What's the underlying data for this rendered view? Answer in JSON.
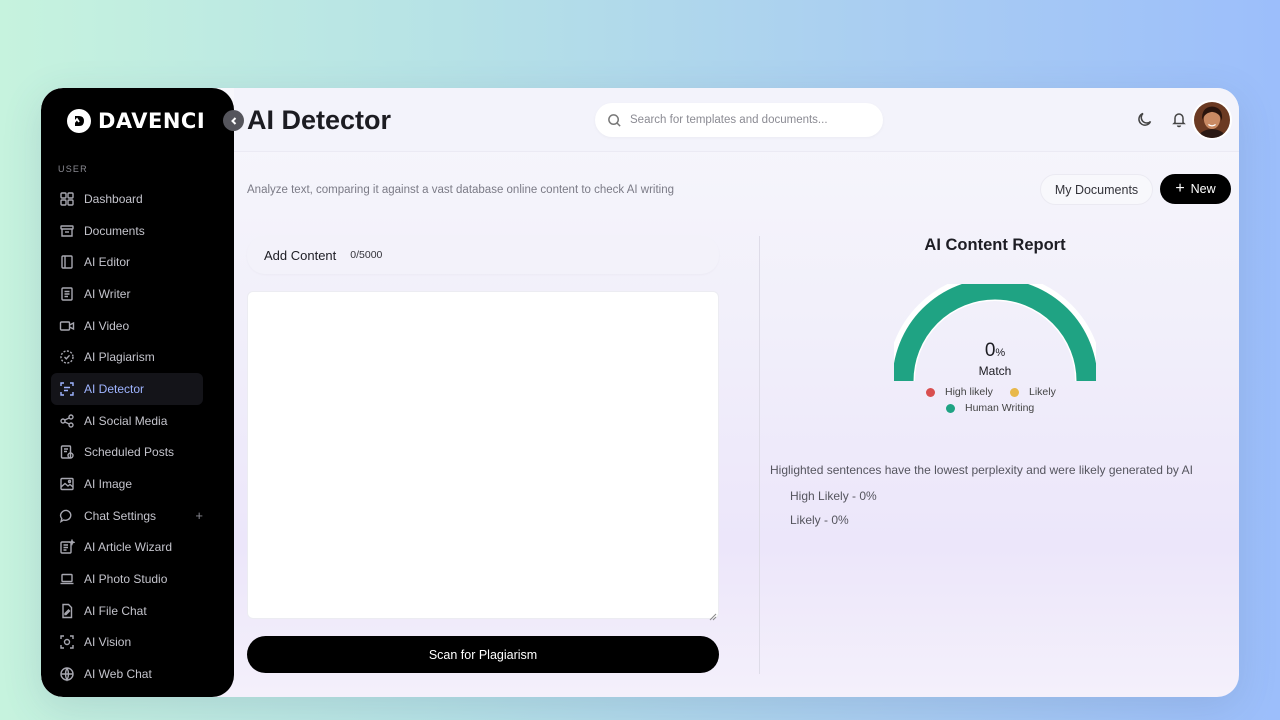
{
  "app": {
    "logo_text": "DAVENCI"
  },
  "sidebar": {
    "section_label": "USER",
    "items": [
      {
        "label": "Dashboard",
        "icon": "dashboard-icon"
      },
      {
        "label": "Documents",
        "icon": "documents-icon"
      },
      {
        "label": "AI Editor",
        "icon": "editor-icon"
      },
      {
        "label": "AI Writer",
        "icon": "writer-icon"
      },
      {
        "label": "AI Video",
        "icon": "video-icon"
      },
      {
        "label": "AI Plagiarism",
        "icon": "plagiarism-icon"
      },
      {
        "label": "AI Detector",
        "icon": "detector-icon",
        "active": true
      },
      {
        "label": "AI Social Media",
        "icon": "share-icon"
      },
      {
        "label": "Scheduled Posts",
        "icon": "calendar-icon"
      },
      {
        "label": "AI Image",
        "icon": "image-icon"
      },
      {
        "label": "Chat Settings",
        "icon": "chat-icon",
        "expandable": true
      },
      {
        "label": "AI Article Wizard",
        "icon": "wizard-icon"
      },
      {
        "label": "AI Photo Studio",
        "icon": "laptop-icon"
      },
      {
        "label": "AI File Chat",
        "icon": "file-icon"
      },
      {
        "label": "AI Vision",
        "icon": "vision-icon"
      },
      {
        "label": "AI Web Chat",
        "icon": "web-icon"
      }
    ]
  },
  "header": {
    "title": "AI Detector",
    "search_placeholder": "Search for templates and documents..."
  },
  "page": {
    "subtitle": "Analyze text, comparing it against a vast database online content to check AI writing",
    "my_documents_label": "My Documents",
    "new_label": "New"
  },
  "editor": {
    "add_content_label": "Add Content",
    "char_count": "0/5000",
    "text_value": "",
    "scan_button_label": "Scan for Plagiarism"
  },
  "report": {
    "title": "AI Content Report",
    "match_value": "0",
    "match_unit": "%",
    "match_label": "Match",
    "match_fraction": 0,
    "legend": [
      {
        "label": "High likely",
        "color": "#d94f4f"
      },
      {
        "label": "Likely",
        "color": "#e8b84a"
      },
      {
        "label": "Human Writing",
        "color": "#1fa383"
      }
    ],
    "note": "Higlighted sentences have the lowest perplexity and were likely generated by AI",
    "high_likely_text": "High Likely - 0%",
    "likely_text": "Likely - 0%"
  },
  "colors": {
    "gauge_fill": "#1fa383",
    "accent_active": "#9fb4ff"
  }
}
